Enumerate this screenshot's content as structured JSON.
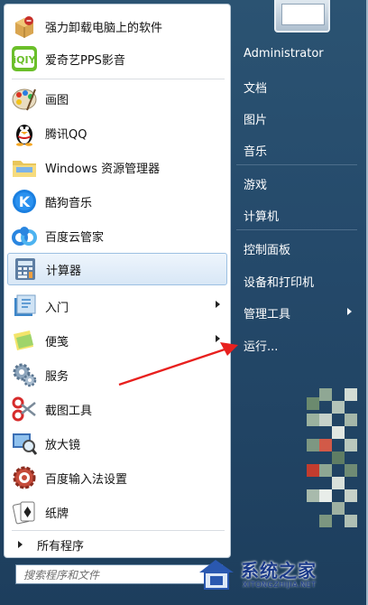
{
  "programs": [
    {
      "label": "强力卸载电脑上的软件",
      "icon": "uninstall-box-icon"
    },
    {
      "label": "爱奇艺PPS影音",
      "icon": "iqiyi-icon"
    },
    {
      "label": "画图",
      "icon": "paint-icon"
    },
    {
      "label": "腾讯QQ",
      "icon": "qq-penguin-icon"
    },
    {
      "label": "Windows 资源管理器",
      "icon": "folder-explorer-icon"
    },
    {
      "label": "酷狗音乐",
      "icon": "kugou-icon"
    },
    {
      "label": "百度云管家",
      "icon": "baidu-cloud-icon"
    },
    {
      "label": "计算器",
      "icon": "calculator-icon"
    },
    {
      "label": "入门",
      "icon": "getting-started-icon"
    },
    {
      "label": "便笺",
      "icon": "sticky-notes-icon"
    },
    {
      "label": "服务",
      "icon": "services-gear-icon"
    },
    {
      "label": "截图工具",
      "icon": "snipping-scissors-icon"
    },
    {
      "label": "放大镜",
      "icon": "magnifier-icon"
    },
    {
      "label": "百度输入法设置",
      "icon": "baidu-ime-settings-icon"
    },
    {
      "label": "纸牌",
      "icon": "solitaire-cards-icon"
    }
  ],
  "all_programs": "所有程序",
  "search_placeholder": "搜索程序和文件",
  "right_items": [
    {
      "label": "Administrator"
    },
    {
      "label": "文档"
    },
    {
      "label": "图片"
    },
    {
      "label": "音乐"
    },
    {
      "label": "游戏"
    },
    {
      "label": "计算机"
    },
    {
      "label": "控制面板"
    },
    {
      "label": "设备和打印机"
    },
    {
      "label": "管理工具"
    },
    {
      "label": "运行..."
    }
  ],
  "watermark": {
    "title": "系统之家",
    "url": "XITONGZHIJIA.NET"
  },
  "colors": {
    "selected_bg": "#d8e7f6",
    "menu_bg": "#254a6b",
    "annotation_red": "#e8201e"
  }
}
